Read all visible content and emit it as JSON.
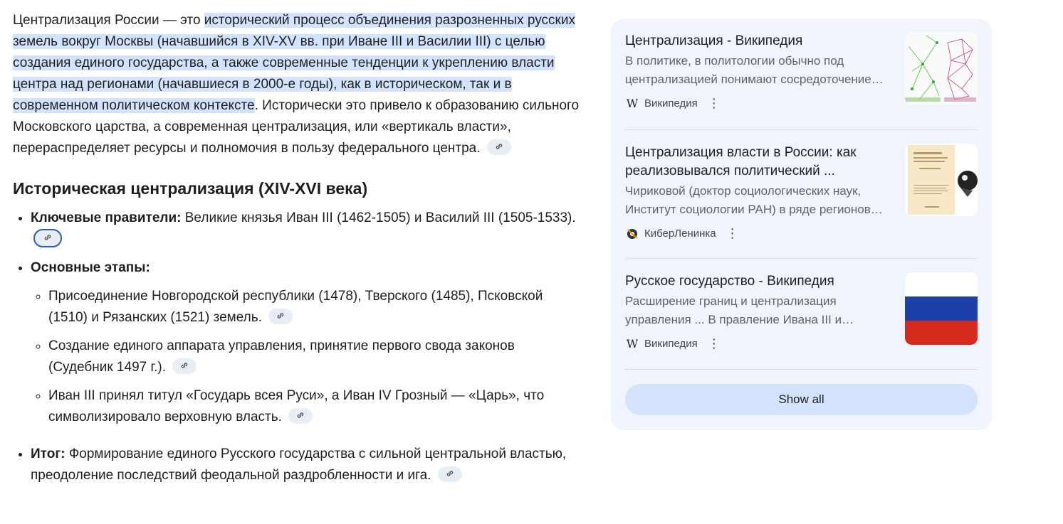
{
  "intro": {
    "prefix": "Централизация России — это ",
    "highlighted": "исторический процесс объединения разрозненных русских земель вокруг Москвы (начавшийся в XIV-XV вв. при Иване III и Василии III) с целью создания единого государства, а также современные тенденции к укреплению власти центра над регионами (начавшиеся в 2000-е годы), как в историческом, так и в современном политическом контексте",
    "suffix": ". Исторически это привело к образованию сильного Московского царства, а современная централизация, или «вертикаль власти», перераспределяет ресурсы и полномочия в пользу федерального центра."
  },
  "section_title": "Историческая централизация (XIV-XVI века)",
  "bullets": {
    "rulers_label": "Ключевые правители:",
    "rulers_text": " Великие князья Иван III (1462-1505) и Василий III (1505-1533).",
    "stages_label": "Основные этапы:",
    "stages": [
      "Присоединение Новгородской республики (1478), Тверского (1485), Псковской (1510) и Рязанских (1521) земель.",
      "Создание единого аппарата управления, принятие первого свода законов (Судебник 1497 г.).",
      "Иван III принял титул «Государь всея Руси», а Иван IV Грозный — «Царь», что символизировало верховную власть."
    ],
    "result_label": "Итог:",
    "result_text": " Формирование единого Русского государства с сильной центральной властью, преодоление последствий феодальной раздробленности и ига."
  },
  "sources": [
    {
      "title": "Централизация - Википедия",
      "snippet_1": "В политике, в политологии обычно под",
      "snippet_2": "централизацией понимают сосредоточение…",
      "source": "Википедия",
      "logo": "W"
    },
    {
      "title": "Централизация власти в России: как реализовывался политический ...",
      "snippet_1": "Чириковой (доктор социологических наук,",
      "snippet_2": "Институт социологии РАН) в ряде регионов…",
      "source": "КиберЛенинка",
      "logo": "cyberleninka-icon"
    },
    {
      "title": "Русское государство - Википедия",
      "snippet_1": "Расширение границ и централизация",
      "snippet_2": "управления ... В правление Ивана III и…",
      "source": "Википедия",
      "logo": "W"
    }
  ],
  "show_all": "Show all",
  "colors": {
    "highlight": "#d3e3fd",
    "panel": "#f0f4fc",
    "flag_white": "#ffffff",
    "flag_blue": "#1c3fa8",
    "flag_red": "#d52b1e"
  }
}
